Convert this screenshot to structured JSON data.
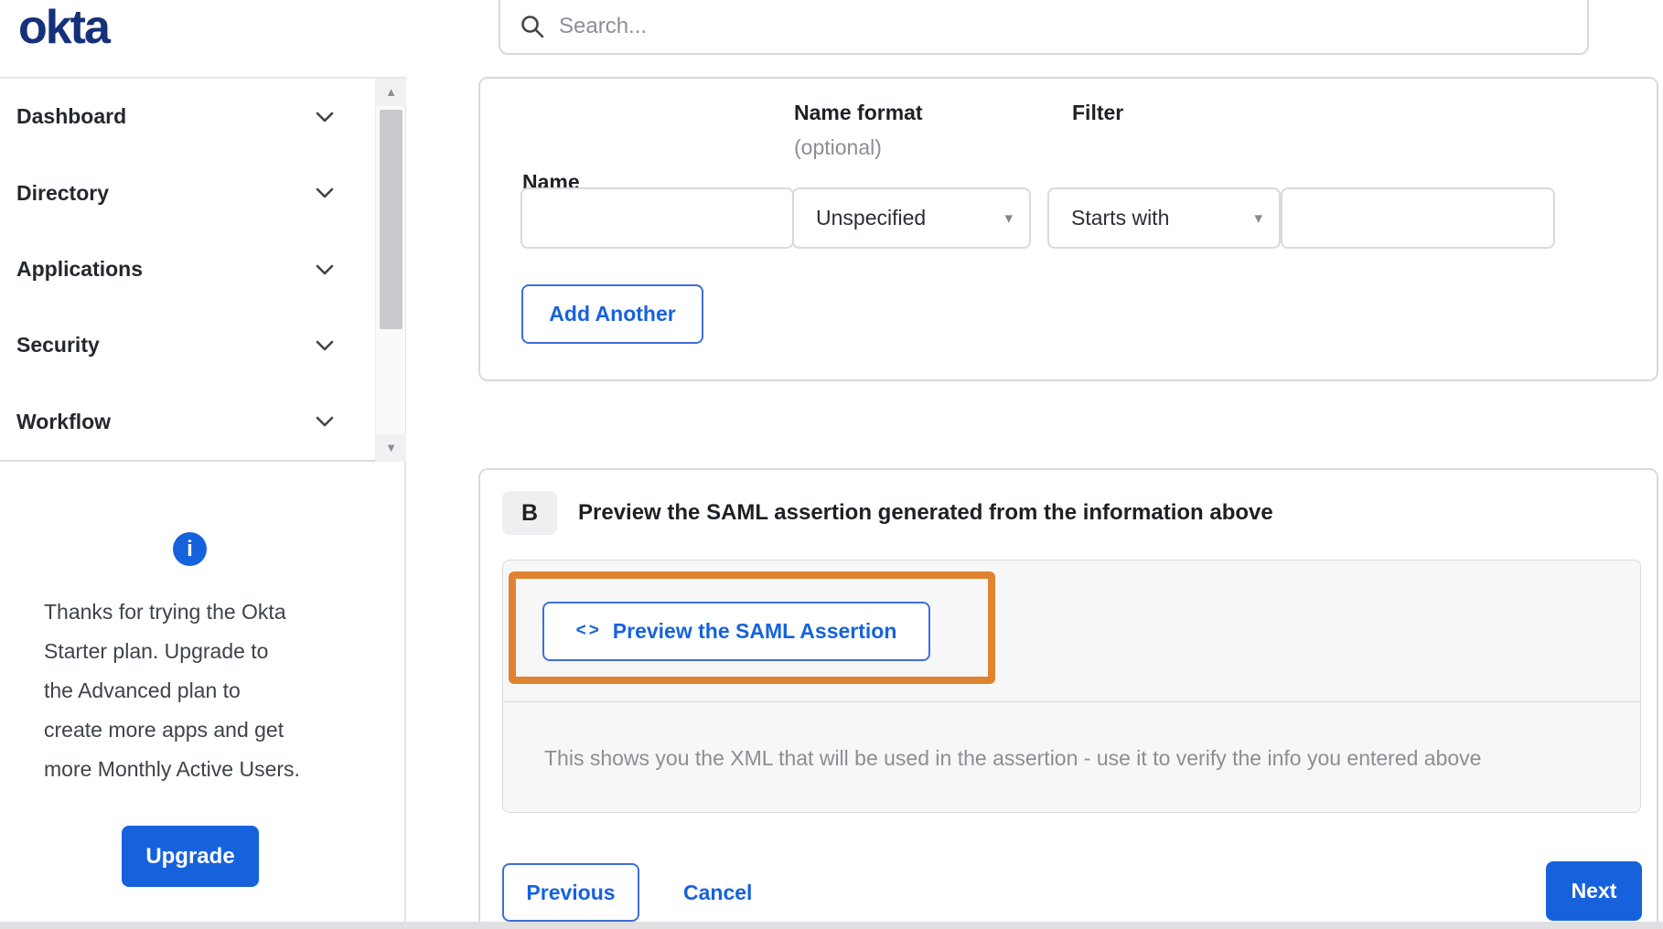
{
  "brand": {
    "logo_text": "okta"
  },
  "topbar": {
    "search_placeholder": "Search..."
  },
  "sidebar": {
    "items": [
      {
        "label": "Dashboard"
      },
      {
        "label": "Directory"
      },
      {
        "label": "Applications"
      },
      {
        "label": "Security"
      },
      {
        "label": "Workflow"
      }
    ],
    "trial_notice": {
      "lines": [
        "Thanks for trying the Okta",
        "Starter plan. Upgrade to",
        "the Advanced plan to",
        "create more apps and get",
        "more Monthly Active Users."
      ],
      "upgrade_label": "Upgrade"
    }
  },
  "attribute_form": {
    "name_label": "Name",
    "name_format_label": "Name format",
    "name_format_hint": "(optional)",
    "filter_label": "Filter",
    "name_value": "",
    "name_format_value": "Unspecified",
    "filter_type_value": "Starts with",
    "filter_value": "",
    "add_another_label": "Add Another"
  },
  "preview_section": {
    "badge": "B",
    "heading": "Preview the SAML assertion generated from the information above",
    "preview_button_icon": "<>",
    "preview_button_label": "Preview the SAML Assertion",
    "description": "This shows you the XML that will be used in the assertion - use it to verify the info you entered above"
  },
  "wizard_footer": {
    "previous_label": "Previous",
    "cancel_label": "Cancel",
    "next_label": "Next"
  },
  "icons": {
    "info": "i",
    "select_caret": "▾",
    "scroll_up": "▲",
    "scroll_down": "▼"
  },
  "colors": {
    "primary_blue": "#1662dd",
    "logo_navy": "#16307a",
    "annotation_orange": "#e08330",
    "panel_gray": "#f7f7f8",
    "border_gray": "#d9d9de",
    "text_dark": "#1d2025",
    "text_gray": "#8d8d94"
  }
}
